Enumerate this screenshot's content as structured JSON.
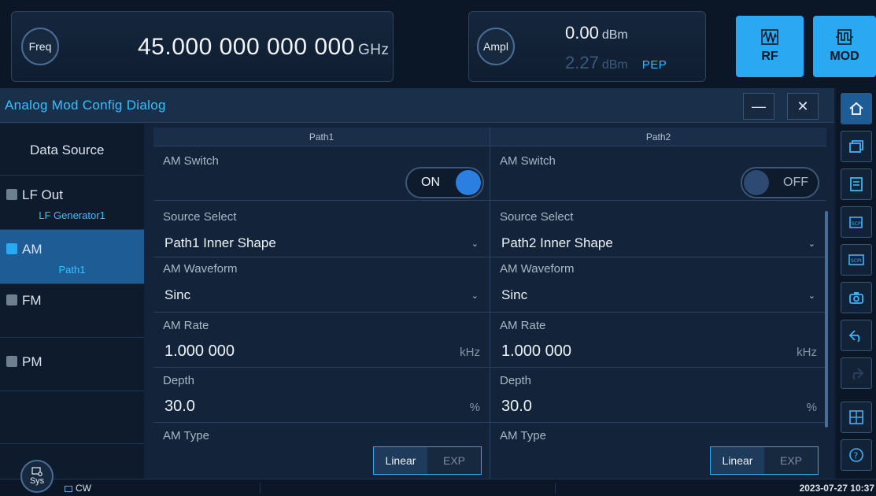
{
  "freq": {
    "button": "Freq",
    "value": "45.000 000 000 000",
    "unit": "GHz"
  },
  "ampl": {
    "button": "Ampl",
    "value": "0.00",
    "unit": "dBm",
    "pep_value": "2.27",
    "pep_unit": "dBm",
    "pep_label": "PEP"
  },
  "rf": {
    "label": "RF"
  },
  "mod": {
    "label": "MOD"
  },
  "dialog": {
    "title": "Analog Mod Config Dialog",
    "minimize": "—",
    "close": "✕"
  },
  "sidebar": {
    "items": [
      {
        "label": "Data Source",
        "sub": ""
      },
      {
        "label": "LF Out",
        "sub": "LF Generator1"
      },
      {
        "label": "AM",
        "sub": "Path1"
      },
      {
        "label": "FM",
        "sub": ""
      },
      {
        "label": "PM",
        "sub": ""
      }
    ]
  },
  "paths": [
    {
      "header": "Path1",
      "am_switch_label": "AM Switch",
      "am_switch_state": "ON",
      "source_label": "Source Select",
      "source_value": "Path1 Inner Shape",
      "waveform_label": "AM Waveform",
      "waveform_value": "Sinc",
      "rate_label": "AM Rate",
      "rate_value": "1.000 000",
      "rate_unit": "kHz",
      "depth_label": "Depth",
      "depth_value": "30.0",
      "depth_unit": "%",
      "type_label": "AM Type",
      "type_linear": "Linear",
      "type_exp": "EXP"
    },
    {
      "header": "Path2",
      "am_switch_label": "AM Switch",
      "am_switch_state": "OFF",
      "source_label": "Source Select",
      "source_value": "Path2 Inner Shape",
      "waveform_label": "AM Waveform",
      "waveform_value": "Sinc",
      "rate_label": "AM Rate",
      "rate_value": "1.000 000",
      "rate_unit": "kHz",
      "depth_label": "Depth",
      "depth_value": "30.0",
      "depth_unit": "%",
      "type_label": "AM Type",
      "type_linear": "Linear",
      "type_exp": "EXP"
    }
  ],
  "status": {
    "sys": "Sys",
    "mode": "CW",
    "timestamp": "2023-07-27 10:37"
  },
  "colors": {
    "accent": "#2aa8f2",
    "title": "#33c2ff",
    "active": "#1d5c95"
  }
}
